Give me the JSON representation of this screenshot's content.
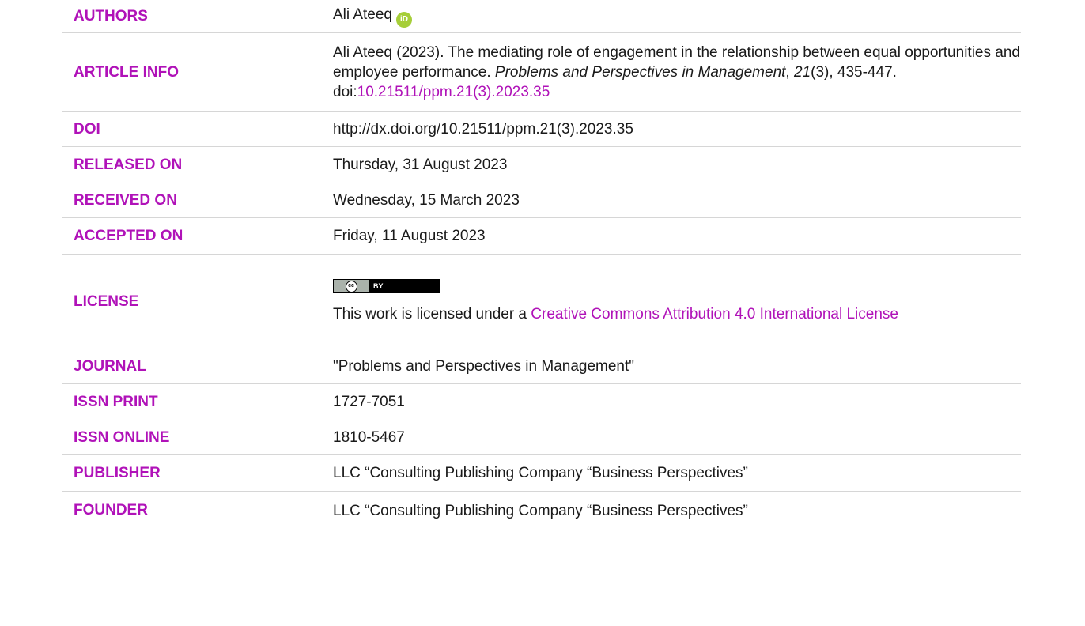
{
  "rows": {
    "authors": {
      "label": "AUTHORS",
      "name": "Ali Ateeq",
      "orcid_icon": "orcid-icon",
      "orcid_text": "iD"
    },
    "article_info": {
      "label": "ARTICLE INFO",
      "citation_prefix": "Ali Ateeq (2023). The mediating role of engagement in the relationship between equal opportunities and employee performance. ",
      "journal_italic": "Problems and Perspectives in Management",
      "sep1": ", ",
      "volume_italic": "21",
      "issue_pages": "(3), 435-447. doi:",
      "doi_link": "10.21511/ppm.21(3).2023.35"
    },
    "doi": {
      "label": "DOI",
      "value": "http://dx.doi.org/10.21511/ppm.21(3).2023.35"
    },
    "released": {
      "label": "RELEASED ON",
      "value": "Thursday, 31 August 2023"
    },
    "received": {
      "label": "RECEIVED ON",
      "value": "Wednesday, 15 March 2023"
    },
    "accepted": {
      "label": "ACCEPTED ON",
      "value": "Friday, 11 August 2023"
    },
    "license": {
      "label": "LICENSE",
      "badge_cc": "cc",
      "badge_by": "BY",
      "text_prefix": "This work is licensed under a ",
      "link_text": "Creative Commons Attribution 4.0 International License"
    },
    "journal": {
      "label": "JOURNAL",
      "value": "\"Problems and Perspectives in Management\""
    },
    "issn_print": {
      "label": "ISSN PRINT",
      "value": "1727-7051"
    },
    "issn_online": {
      "label": "ISSN ONLINE",
      "value": "1810-5467"
    },
    "publisher": {
      "label": "PUBLISHER",
      "value": "LLC “Consulting Publishing Company “Business Perspectives”"
    },
    "founder": {
      "label": "FOUNDER",
      "value": "LLC “Consulting Publishing Company “Business Perspectives”"
    }
  },
  "colors": {
    "label_accent": "#b012b8",
    "orcid_green": "#a6ce39",
    "divider": "#d6d6d6"
  }
}
